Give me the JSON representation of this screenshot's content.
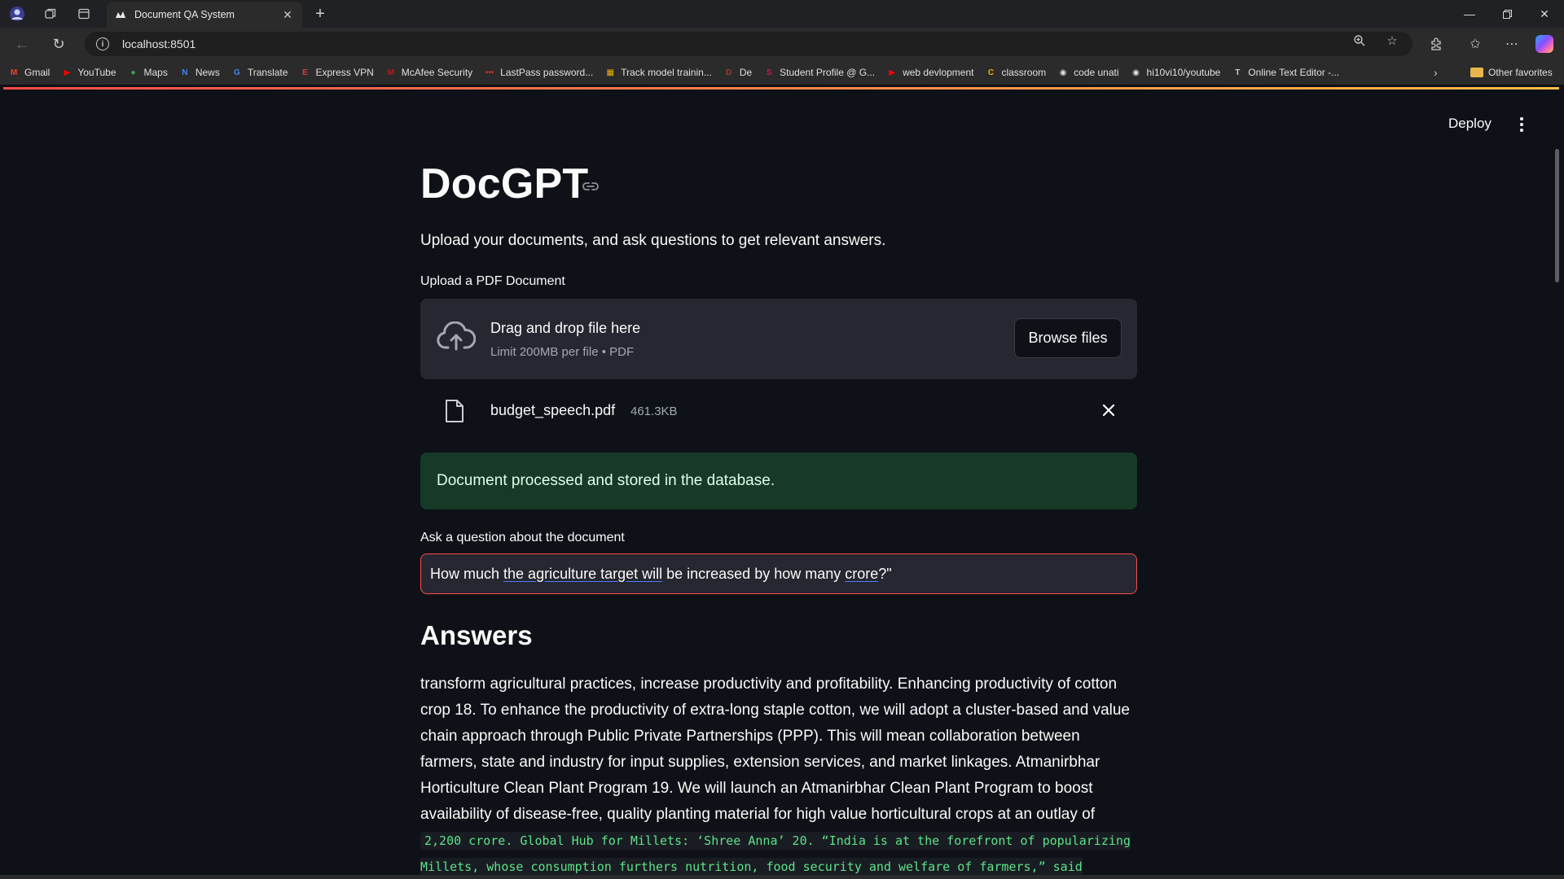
{
  "browser": {
    "tab_title": "Document QA System",
    "url": "localhost:8501",
    "bookmarks": [
      {
        "label": "Gmail",
        "icon": "gmail-icon",
        "color": "#ea4335",
        "glyph": "M"
      },
      {
        "label": "YouTube",
        "icon": "youtube-icon",
        "color": "#ff0000",
        "glyph": "▶"
      },
      {
        "label": "Maps",
        "icon": "maps-icon",
        "color": "#34a853",
        "glyph": "●"
      },
      {
        "label": "News",
        "icon": "news-icon",
        "color": "#4285f4",
        "glyph": "N"
      },
      {
        "label": "Translate",
        "icon": "translate-icon",
        "color": "#4285f4",
        "glyph": "G"
      },
      {
        "label": "Express VPN",
        "icon": "expressvpn-icon",
        "color": "#da3940",
        "glyph": "E"
      },
      {
        "label": "McAfee Security",
        "icon": "mcafee-icon",
        "color": "#c01818",
        "glyph": "M"
      },
      {
        "label": "LastPass password...",
        "icon": "lastpass-icon",
        "color": "#d32d27",
        "glyph": "•••"
      },
      {
        "label": "Track model trainin...",
        "icon": "wandb-icon",
        "color": "#f4b400",
        "glyph": "▦"
      },
      {
        "label": "De",
        "icon": "de-icon",
        "color": "#9a3a3a",
        "glyph": "D"
      },
      {
        "label": "Student Profile @ G...",
        "icon": "student-profile-icon",
        "color": "#c2185b",
        "glyph": "S"
      },
      {
        "label": "web devlopment",
        "icon": "youtube-icon",
        "color": "#ff0000",
        "glyph": "▶"
      },
      {
        "label": "classroom",
        "icon": "classroom-icon",
        "color": "#f4b400",
        "glyph": "C"
      },
      {
        "label": "code unati",
        "icon": "github-icon",
        "color": "#e0e0e0",
        "glyph": "◉"
      },
      {
        "label": "hi10vi10/youtube",
        "icon": "github-icon",
        "color": "#e0e0e0",
        "glyph": "◉"
      },
      {
        "label": "Online Text Editor -...",
        "icon": "text-editor-icon",
        "color": "#cccccc",
        "glyph": "T"
      }
    ],
    "other_favorites": "Other favorites"
  },
  "app": {
    "deploy_label": "Deploy",
    "title": "DocGPT",
    "subtitle": "Upload your documents, and ask questions to get relevant answers.",
    "upload": {
      "label": "Upload a PDF Document",
      "drag_text": "Drag and drop file here",
      "limit_text": "Limit 200MB per file • PDF",
      "browse_label": "Browse files"
    },
    "file": {
      "name": "budget_speech.pdf",
      "size": "461.3KB"
    },
    "success_message": "Document processed and stored in the database.",
    "question": {
      "label": "Ask a question about the document",
      "value_parts": [
        "How much ",
        "the agriculture target will",
        " be increased by how many ",
        "crore",
        "?\""
      ]
    },
    "answers_heading": "Answers",
    "answer_text": "transform agricultural practices, increase productivity and profitability. Enhancing productivity of cotton crop 18. To enhance the productivity of extra-long staple cotton, we will adopt a cluster-based and value chain approach through Public Private Partnerships (PPP). This will mean collaboration between farmers, state and industry for input supplies, extension services, and market linkages. Atmanirbhar Horticulture Clean Plant Program 19. We will launch an Atmanirbhar Clean Plant Program to boost availability of disease-free, quality planting material for high value horticultural crops at an outlay of ",
    "answer_code": "2,200 crore. Global Hub for Millets: ‘Shree Anna’ 20. “India is at the forefront of popularizing Millets, whose consumption furthers nutrition, food security and welfare of farmers,” said Hon’ble Prime"
  },
  "colors": {
    "background": "#0e1117",
    "panel": "#262730",
    "success_bg": "#173928",
    "input_focus": "#ff4b4b",
    "code_text": "#5ce488"
  }
}
